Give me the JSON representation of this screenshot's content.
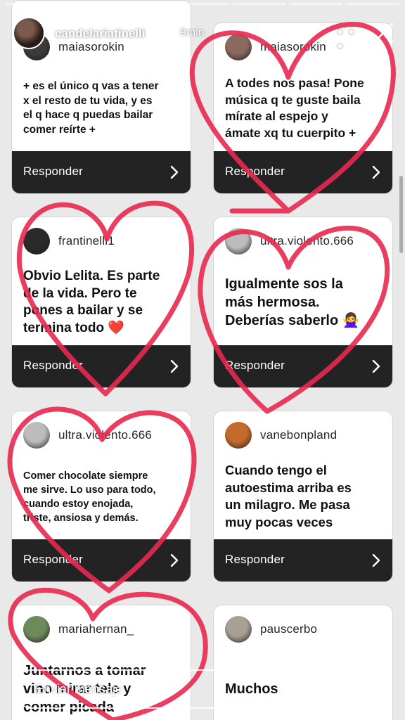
{
  "story": {
    "username": "candelariatinelli",
    "time": "9min",
    "more_icon": "more-horizontal-icon",
    "close_icon": "close-icon",
    "progress_segments": 7
  },
  "reply_label": "Responder",
  "cards": [
    {
      "username": "maiasorokin",
      "message": "+ es el único q vas a tener\nx el resto de tu vida, y es\nel q hace q puedas bailar\ncomer reírte +",
      "avatar_color": "#3b3b3b"
    },
    {
      "username": "maiasorokin",
      "message": "A todes nos pasa! Pone\nmúsica q te guste baila\nmírate al espejo y\námate xq tu cuerpito +",
      "avatar_color": "#8a6a5e"
    },
    {
      "username": "frantinelli1",
      "message": "Obvio Lelita. Es parte\nde la vida. Pero te\npones a bailar y se\ntermina todo ❤️",
      "avatar_color": "#2a2a2a"
    },
    {
      "username": "ultra.violento.666",
      "message": "Igualmente sos la\nmás hermosa.\nDeberías saberlo 🙅‍♀️",
      "avatar_color": "#bcbcbc"
    },
    {
      "username": "ultra.violento.666",
      "message": "Comer chocolate siempre\nme sirve. Lo uso para todo,\ncuando estoy enojada,\ntriste, ansiosa y demás.",
      "avatar_color": "#bcbcbc"
    },
    {
      "username": "vanebonpland",
      "message": "Cuando tengo el\nautoestima arriba es\nun milagro. Me pasa\nmuy pocas veces",
      "avatar_color": "#c46a2c"
    },
    {
      "username": "mariahernan_",
      "message": "Juntarnos a tomar\nvino mirar tele y\ncomer picada",
      "avatar_color": "#6f8a5a"
    },
    {
      "username": "pauscerbo",
      "message": "Muchos",
      "avatar_color": "#a9a094"
    }
  ],
  "compose": {
    "placeholder": "Enviar mensaje",
    "send_icon": "send-icon"
  },
  "colors": {
    "doodle": "#e8294f",
    "reply_bar": "#232323"
  }
}
